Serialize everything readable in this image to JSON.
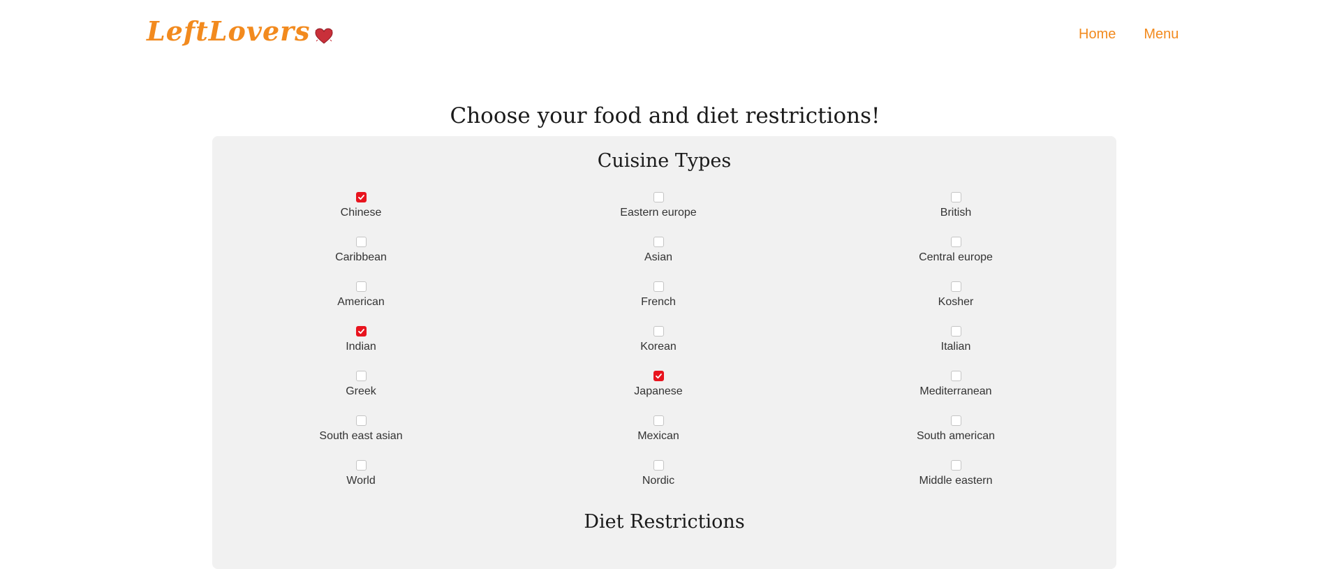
{
  "header": {
    "logo_text": "LeftLovers",
    "logo_icon": "heart-icon",
    "nav": [
      {
        "label": "Home"
      },
      {
        "label": "Menu"
      }
    ]
  },
  "page": {
    "title": "Choose your food and diet restrictions!"
  },
  "cuisine": {
    "title": "Cuisine Types",
    "options": [
      {
        "label": "Chinese",
        "checked": true
      },
      {
        "label": "Eastern europe",
        "checked": false
      },
      {
        "label": "British",
        "checked": false
      },
      {
        "label": "Caribbean",
        "checked": false
      },
      {
        "label": "Asian",
        "checked": false
      },
      {
        "label": "Central europe",
        "checked": false
      },
      {
        "label": "American",
        "checked": false
      },
      {
        "label": "French",
        "checked": false
      },
      {
        "label": "Kosher",
        "checked": false
      },
      {
        "label": "Indian",
        "checked": true
      },
      {
        "label": "Korean",
        "checked": false
      },
      {
        "label": "Italian",
        "checked": false
      },
      {
        "label": "Greek",
        "checked": false
      },
      {
        "label": "Japanese",
        "checked": true
      },
      {
        "label": "Mediterranean",
        "checked": false
      },
      {
        "label": "South east asian",
        "checked": false
      },
      {
        "label": "Mexican",
        "checked": false
      },
      {
        "label": "South american",
        "checked": false
      },
      {
        "label": "World",
        "checked": false
      },
      {
        "label": "Nordic",
        "checked": false
      },
      {
        "label": "Middle eastern",
        "checked": false
      }
    ]
  },
  "diet": {
    "title": "Diet Restrictions"
  },
  "colors": {
    "brand": "#f28a1e",
    "checked": "#e8141e",
    "panel_bg": "#f1f1f1"
  }
}
